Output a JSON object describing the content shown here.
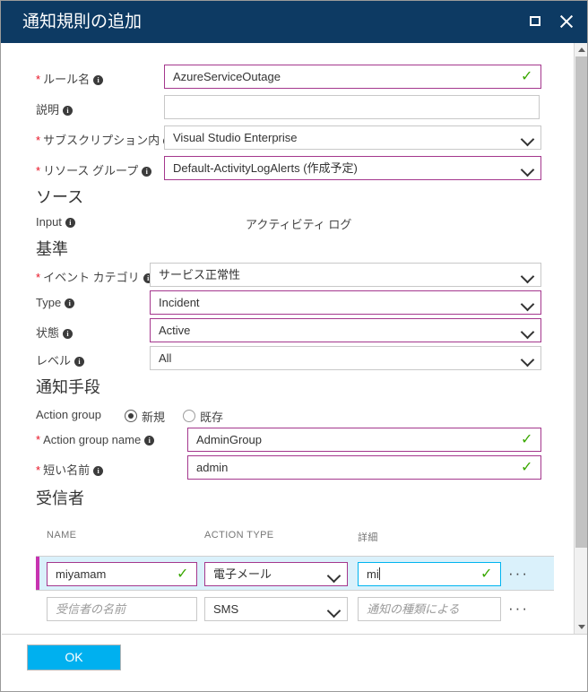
{
  "titlebar": {
    "title": "通知規則の追加",
    "maximize_icon": "maximize-icon",
    "close_icon": "close-icon"
  },
  "basics": {
    "rule_name": {
      "label": "ルール名",
      "required": true,
      "value": "AzureServiceOutage",
      "valid": true
    },
    "description": {
      "label": "説明",
      "required": false,
      "value": "",
      "placeholder": ""
    },
    "subscription": {
      "label": "サブスクリプション内",
      "required": true,
      "value": "Visual Studio Enterprise"
    },
    "resource_group": {
      "label": "リソース グループ",
      "required": true,
      "value": "Default-ActivityLogAlerts (作成予定)"
    }
  },
  "source": {
    "heading": "ソース",
    "input": {
      "label": "Input",
      "value": "アクティビティ ログ"
    }
  },
  "criteria": {
    "heading": "基準",
    "event_category": {
      "label": "イベント カテゴリ",
      "required": true,
      "value": "サービス正常性"
    },
    "type": {
      "label": "Type",
      "required": false,
      "value": "Incident"
    },
    "status": {
      "label": "状態",
      "required": false,
      "value": "Active"
    },
    "level": {
      "label": "レベル",
      "required": false,
      "value": "All"
    }
  },
  "notification": {
    "heading": "通知手段",
    "action_group": {
      "label": "Action group",
      "options": [
        {
          "label": "新規",
          "selected": true
        },
        {
          "label": "既存",
          "selected": false
        }
      ]
    },
    "action_group_name": {
      "label": "Action group name",
      "required": true,
      "value": "AdminGroup",
      "valid": true
    },
    "short_name": {
      "label": "短い名前",
      "required": true,
      "value": "admin",
      "valid": true
    }
  },
  "receivers": {
    "heading": "受信者",
    "columns": [
      "NAME",
      "ACTION TYPE",
      "詳細"
    ],
    "rows": [
      {
        "selected": true,
        "name": {
          "value": "miyamam",
          "placeholder": "受信者の名前",
          "valid": true
        },
        "action_type": {
          "value": "電子メール"
        },
        "detail": {
          "value": "mi",
          "placeholder": "通知の種類による",
          "valid": true,
          "focused": true
        },
        "menu": "···"
      },
      {
        "selected": false,
        "name": {
          "value": "",
          "placeholder": "受信者の名前",
          "valid": false
        },
        "action_type": {
          "value": "SMS"
        },
        "detail": {
          "value": "",
          "placeholder": "通知の種類による",
          "valid": false,
          "focused": false
        },
        "menu": "···"
      }
    ]
  },
  "footer": {
    "ok_label": "OK"
  },
  "colors": {
    "titlebar": "#0d3a63",
    "accent_ok": "#00b0ef",
    "field_modified": "#a4378d",
    "field_focus": "#00b4f0",
    "valid_check": "#3aa800",
    "required_star": "#e81123",
    "row_selected": "#daf1fb",
    "row_accent": "#c733b0"
  },
  "scrollbar": {
    "up_icon": "scroll-up-arrow-icon",
    "down_icon": "scroll-down-arrow-icon"
  }
}
